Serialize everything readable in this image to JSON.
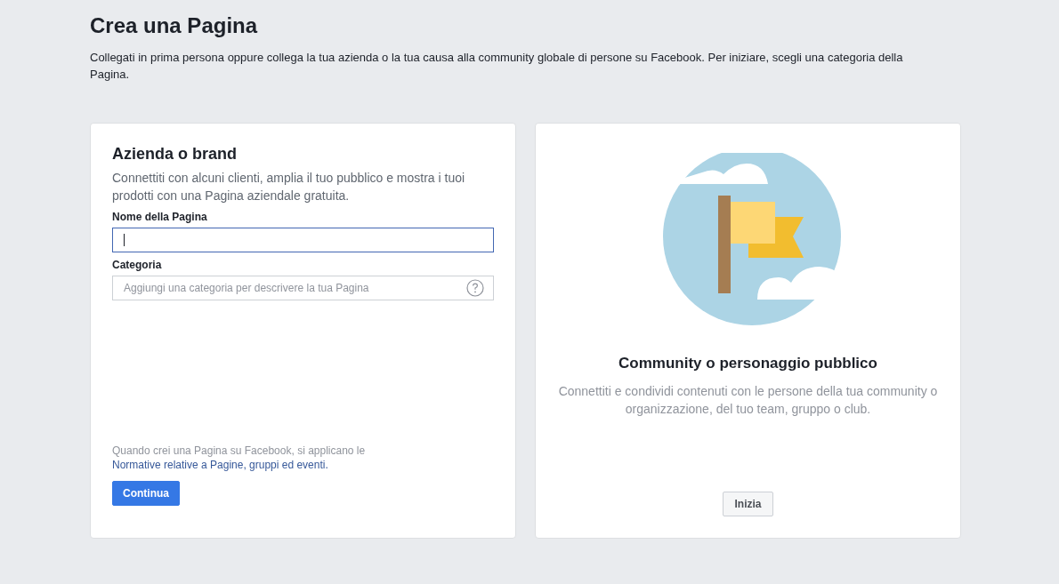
{
  "page": {
    "title": "Crea una Pagina",
    "intro": "Collegati in prima persona oppure collega la tua azienda o la tua causa alla community globale di persone su Facebook. Per iniziare, scegli una categoria della Pagina."
  },
  "business_card": {
    "title": "Azienda o brand",
    "description": "Connettiti con alcuni clienti, amplia il tuo pubblico e mostra i tuoi prodotti con una Pagina aziendale gratuita.",
    "fields": [
      {
        "label": "Nome della Pagina",
        "focused": true,
        "has_help": false
      },
      {
        "label": "Categoria",
        "placeholder": "Aggiungi una categoria per descrivere la tua Pagina",
        "focused": false,
        "has_help": true
      }
    ],
    "legal_text": "Quando crei una Pagina su Facebook, si applicano le ",
    "legal_link": "Normative relative a Pagine, gruppi ed eventi.",
    "button": "Continua"
  },
  "community_card": {
    "title": "Community o personaggio pubblico",
    "description": "Connettiti e condividi contenuti con le persone della tua community o organizzazione, del tuo team, gruppo o club.",
    "button": "Inizia"
  }
}
